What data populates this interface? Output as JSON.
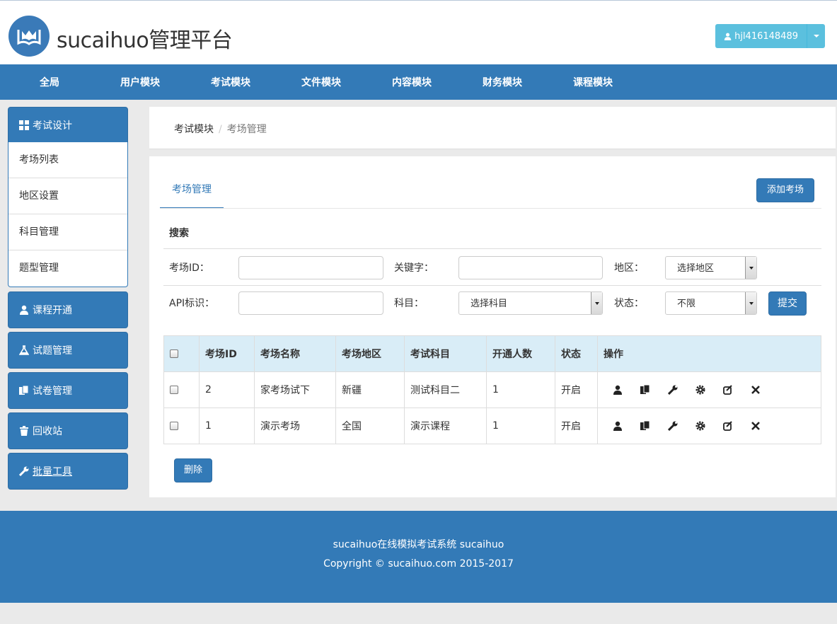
{
  "header": {
    "brand": "sucaihuo管理平台",
    "user": "hjl416148489",
    "logo_icon": "book-logo-icon"
  },
  "nav": {
    "items": [
      "全局",
      "用户模块",
      "考试模块",
      "文件模块",
      "内容模块",
      "财务模块",
      "课程模块"
    ]
  },
  "sidebar": {
    "exam_design": "考试设计",
    "exam_design_items": [
      "考场列表",
      "地区设置",
      "科目管理",
      "题型管理"
    ],
    "course_open": "课程开通",
    "question_mgmt": "试题管理",
    "paper_mgmt": "试卷管理",
    "recycle": "回收站",
    "batch_tools": "批量工具"
  },
  "breadcrumb": {
    "parent": "考试模块",
    "separator": "/",
    "current": "考场管理"
  },
  "main": {
    "tab": "考场管理",
    "add_button": "添加考场",
    "search_title": "搜索",
    "labels": {
      "room_id": "考场ID：",
      "keyword": "关键字：",
      "region": "地区：",
      "api": "API标识：",
      "subject": "科目：",
      "status": "状态："
    },
    "region_select": "选择地区",
    "subject_select": "选择科目",
    "status_select": "不限",
    "submit": "提交",
    "delete": "删除"
  },
  "table": {
    "headers": [
      "考场ID",
      "考场名称",
      "考场地区",
      "考试科目",
      "开通人数",
      "状态",
      "操作"
    ],
    "rows": [
      {
        "id": "2",
        "name": "家考场试下",
        "region": "新疆",
        "subject": "测试科目二",
        "count": "1",
        "status": "开启"
      },
      {
        "id": "1",
        "name": "演示考场",
        "region": "全国",
        "subject": "演示课程",
        "count": "1",
        "status": "开启"
      }
    ]
  },
  "footer": {
    "line1": "sucaihuo在线模拟考试系统 sucaihuo",
    "line2": "Copyright © sucaihuo.com 2015-2017"
  },
  "colors": {
    "primary": "#337ab7",
    "info": "#5bc0de",
    "table_head": "#d9edf7"
  }
}
